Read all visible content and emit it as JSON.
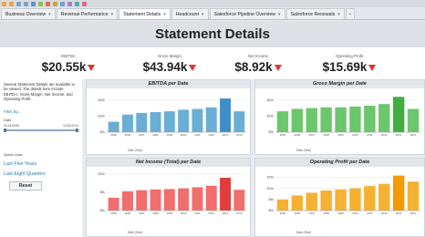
{
  "tabs": [
    {
      "label": "Business Overview",
      "active": false
    },
    {
      "label": "Revenue Performance",
      "active": false
    },
    {
      "label": "Statement Details",
      "active": true
    },
    {
      "label": "Headcount",
      "active": false
    },
    {
      "label": "Salesforce Pipeline Overview",
      "active": false
    },
    {
      "label": "Salesforce Renewals",
      "active": false
    }
  ],
  "header": {
    "title": "Statement Details"
  },
  "kpis": [
    {
      "label": "EBITDA",
      "value": "$20.55k"
    },
    {
      "label": "Gross Margin",
      "value": "$43.94k"
    },
    {
      "label": "Net Income",
      "value": "$8.92k"
    },
    {
      "label": "Operating Profit",
      "value": "$15.69k"
    }
  ],
  "sidebar": {
    "description": "Several Statement Details are available to be viewed. The details here include EBITDA, Gross Margin, Net Income, and Operating Profit.",
    "filter_title": "Filter By...",
    "date_label": "Date",
    "range_start": "01/01/2005",
    "range_end": "12/31/2014",
    "quick_links_label": "Quick Links",
    "links": [
      "Last Five Years",
      "Last Eight Quarters"
    ],
    "reset_label": "Reset"
  },
  "colors": {
    "ebitda": "#6aaed6",
    "gross_margin": "#6cc66c",
    "net_income": "#f26d6d",
    "operating_profit": "#f6b132",
    "highlight_ebitda": "#3f8fc6",
    "highlight_gross": "#3fae3f",
    "highlight_net": "#e23c3c",
    "highlight_op": "#f29a00"
  },
  "chart_data": [
    {
      "type": "bar",
      "title": "EBITDA per Date",
      "categories": [
        "2005",
        "2006",
        "2007",
        "2008",
        "2009",
        "2010",
        "2011",
        "2012",
        "2013",
        "2014"
      ],
      "values": [
        6.5,
        11,
        12,
        12.5,
        13,
        14,
        14.5,
        15.5,
        21,
        13
      ],
      "highlight_index": 8,
      "ylim": [
        0,
        25
      ],
      "ytick_labels": [
        "$0k",
        "$10k",
        "$20k"
      ],
      "ytick_values": [
        0,
        10,
        20
      ],
      "x_footer": "Date (Year)"
    },
    {
      "type": "bar",
      "title": "Gross Margin per Date",
      "categories": [
        "2005",
        "2006",
        "2007",
        "2008",
        "2009",
        "2010",
        "2011",
        "2012",
        "2013",
        "2014"
      ],
      "values": [
        26,
        29,
        30,
        31,
        31,
        32,
        33,
        35,
        44,
        29
      ],
      "highlight_index": 8,
      "ylim": [
        0,
        50
      ],
      "ytick_labels": [
        "$0k",
        "$20k",
        "$40k"
      ],
      "ytick_values": [
        0,
        20,
        40
      ],
      "x_footer": "Date (Year)"
    },
    {
      "type": "bar",
      "title": "Net Income (Total) per Date",
      "categories": [
        "2005",
        "2006",
        "2007",
        "2008",
        "2009",
        "2010",
        "2011",
        "2012",
        "2013",
        "2014"
      ],
      "values": [
        3.5,
        5.3,
        5.6,
        5.8,
        5.9,
        6.1,
        6.4,
        6.8,
        9,
        5.7
      ],
      "highlight_index": 8,
      "ylim": [
        0,
        11
      ],
      "ytick_labels": [
        "$0k",
        "$5k",
        "$10k"
      ],
      "ytick_values": [
        0,
        5,
        10
      ],
      "x_footer": "Date (Year)"
    },
    {
      "type": "bar",
      "title": "Operating Profit per Date",
      "categories": [
        "2005",
        "2006",
        "2007",
        "2008",
        "2009",
        "2010",
        "2011",
        "2012",
        "2013",
        "2014"
      ],
      "values": [
        5,
        6.8,
        8,
        9,
        9.5,
        10,
        11,
        12,
        15.7,
        13
      ],
      "highlight_index": 8,
      "ylim": [
        0,
        18
      ],
      "ytick_labels": [
        "$0k",
        "$5k",
        "$10k",
        "$15k"
      ],
      "ytick_values": [
        0,
        5,
        10,
        15
      ],
      "x_footer": "Date (Year)"
    }
  ]
}
